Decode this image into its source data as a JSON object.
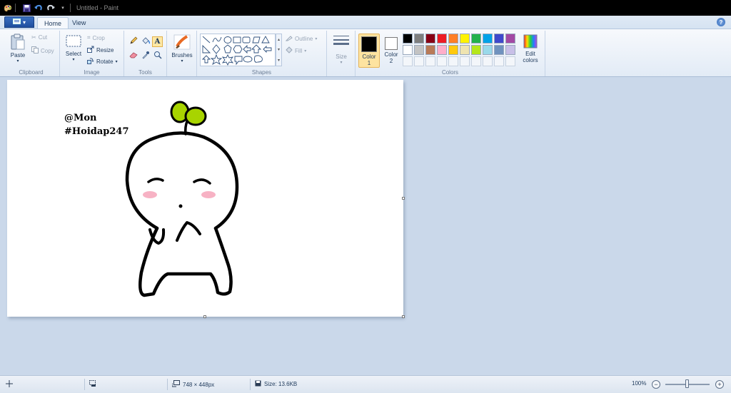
{
  "window": {
    "title": "Untitled - Paint"
  },
  "tabs": {
    "file_icon": "file-menu-icon",
    "home": "Home",
    "view": "View",
    "help": "?"
  },
  "clipboard": {
    "paste": "Paste",
    "cut": "Cut",
    "copy": "Copy",
    "label": "Clipboard"
  },
  "image": {
    "select": "Select",
    "crop": "Crop",
    "resize": "Resize",
    "rotate": "Rotate",
    "label": "Image"
  },
  "tools": {
    "label": "Tools",
    "selected": "text"
  },
  "brushes": {
    "label": "Brushes"
  },
  "shapes": {
    "outline": "Outline",
    "fill": "Fill",
    "label": "Shapes"
  },
  "size": {
    "label": "Size"
  },
  "colors": {
    "color1_label": "Color",
    "color1_num": "1",
    "color2_label": "Color",
    "color2_num": "2",
    "color1": "#000000",
    "color2": "#ffffff",
    "edit": "Edit",
    "edit2": "colors",
    "label": "Colors",
    "palette": [
      "#000000",
      "#7f7f7f",
      "#880015",
      "#ed1c24",
      "#ff7f27",
      "#fff200",
      "#22b14c",
      "#00a2e8",
      "#3f48cc",
      "#a349a4",
      "#ffffff",
      "#c3c3c3",
      "#b97a57",
      "#ffaec9",
      "#ffc90e",
      "#efe4b0",
      "#b5e61d",
      "#99d9ea",
      "#7092be",
      "#c8bfe7"
    ],
    "empty_slots": 10
  },
  "canvas": {
    "line1": "@Mon",
    "line2": "#Hoidap247",
    "drawing_colors": {
      "stroke": "#000000",
      "sprout": "#a8d400",
      "blush": "#f7b2c4"
    }
  },
  "status": {
    "dimensions": "748 × 448px",
    "size": "Size: 13.6KB",
    "zoom": "100%",
    "zoom_out": "−",
    "zoom_in": "+",
    "zoom_level": 1.0
  }
}
